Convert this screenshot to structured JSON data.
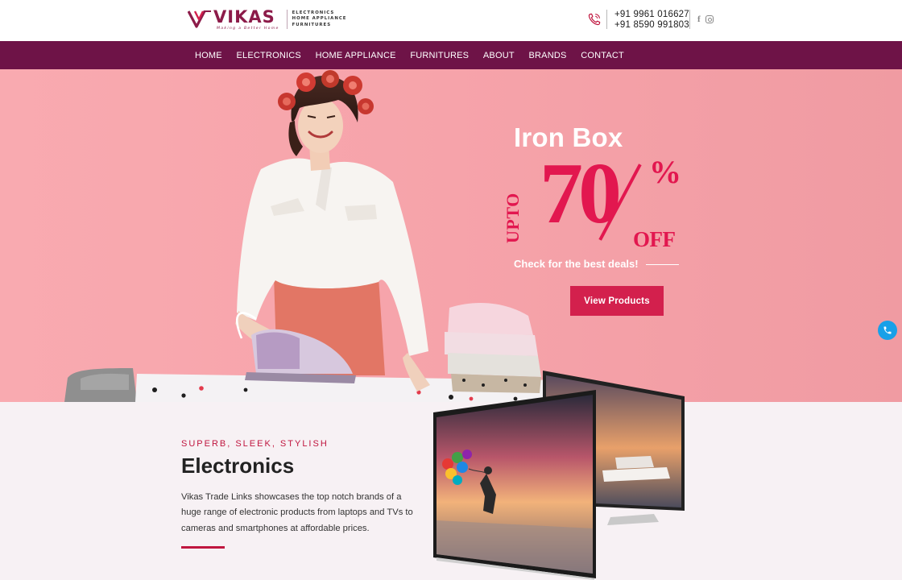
{
  "brand": {
    "name": "VIKAS",
    "tagline": "Making a Better Home",
    "categories": [
      "ELECTRONICS",
      "HOME APPLIANCE",
      "FURNITURES"
    ]
  },
  "contact": {
    "phones": [
      "+91 9961 016627",
      "+91 8590 991803"
    ],
    "facebook_glyph": "f"
  },
  "nav": {
    "items": [
      "HOME",
      "ELECTRONICS",
      "HOME APPLIANCE",
      "FURNITURES",
      "ABOUT",
      "BRANDS",
      "CONTACT"
    ]
  },
  "hero": {
    "title": "Iron Box",
    "upto": "UPTO",
    "discount": "70",
    "percent_sign": "%",
    "off": "OFF",
    "subtitle": "Check for the best deals!",
    "button": "View Products"
  },
  "section": {
    "eyebrow": "SUPERB, SLEEK, STYLISH",
    "title": "Electronics",
    "body": "Vikas Trade Links showcases the top notch brands of a huge range of electronic products from laptops and TVs to cameras and smartphones at affordable prices."
  },
  "colors": {
    "brand": "#8c1b49",
    "nav_bg": "#6e1347",
    "accent": "#e2174f",
    "hero_bg": "#f6a3aa",
    "button": "#d3204d",
    "float_button": "#18a0e8"
  },
  "icons": [
    "vikas-logo-icon",
    "phone-icon",
    "facebook-icon",
    "instagram-icon",
    "call-icon"
  ]
}
